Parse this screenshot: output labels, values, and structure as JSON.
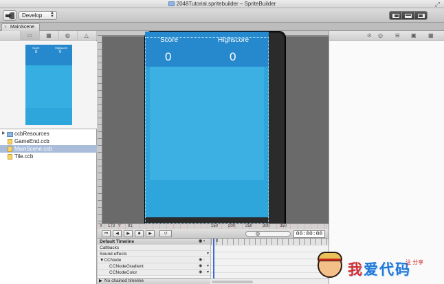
{
  "window": {
    "title": "2048Tutorial.spritebuilder – SpriteBuilder"
  },
  "toolbar": {
    "publish_icon": "publish-icon",
    "target_select": "Develop",
    "panel_icons": [
      "left-panel-icon",
      "bottom-panel-icon",
      "right-panel-icon"
    ]
  },
  "tabs": [
    {
      "label": "MainScene",
      "close": "×"
    }
  ],
  "left_panel": {
    "icons": [
      "folder-icon",
      "grid-icon",
      "component-icon",
      "warning-icon"
    ],
    "preview": {
      "score_label": "Score",
      "highscore_label": "Highscore",
      "score_value": "0",
      "highscore_value": "0"
    },
    "files": [
      {
        "name": "ccbResources",
        "type": "folder",
        "selected": false
      },
      {
        "name": "GameEnd.ccb",
        "type": "file",
        "selected": false
      },
      {
        "name": "MainScene.ccb",
        "type": "file",
        "selected": true
      },
      {
        "name": "Tile.ccb",
        "type": "file",
        "selected": false
      }
    ]
  },
  "canvas": {
    "score_label": "Score",
    "highscore_label": "Highscore",
    "score_value": "0",
    "highscore_value": "0",
    "x_label": "X",
    "x_value": "173",
    "y_label": "Y",
    "y_value": "91",
    "ruler_ticks": [
      "150",
      "200",
      "250",
      "300",
      "350"
    ]
  },
  "timeline": {
    "time": "00:00:00",
    "header": "Default Timeline",
    "rows": [
      "Callbacks",
      "Sound effects",
      "CCNode",
      "CCNodeGradient",
      "CCNodeColor"
    ],
    "footer": "No chained timeline",
    "ruler_start": "0"
  },
  "watermark": {
    "text_a": "我",
    "text_b": "爱代码",
    "small": "注 分享"
  }
}
